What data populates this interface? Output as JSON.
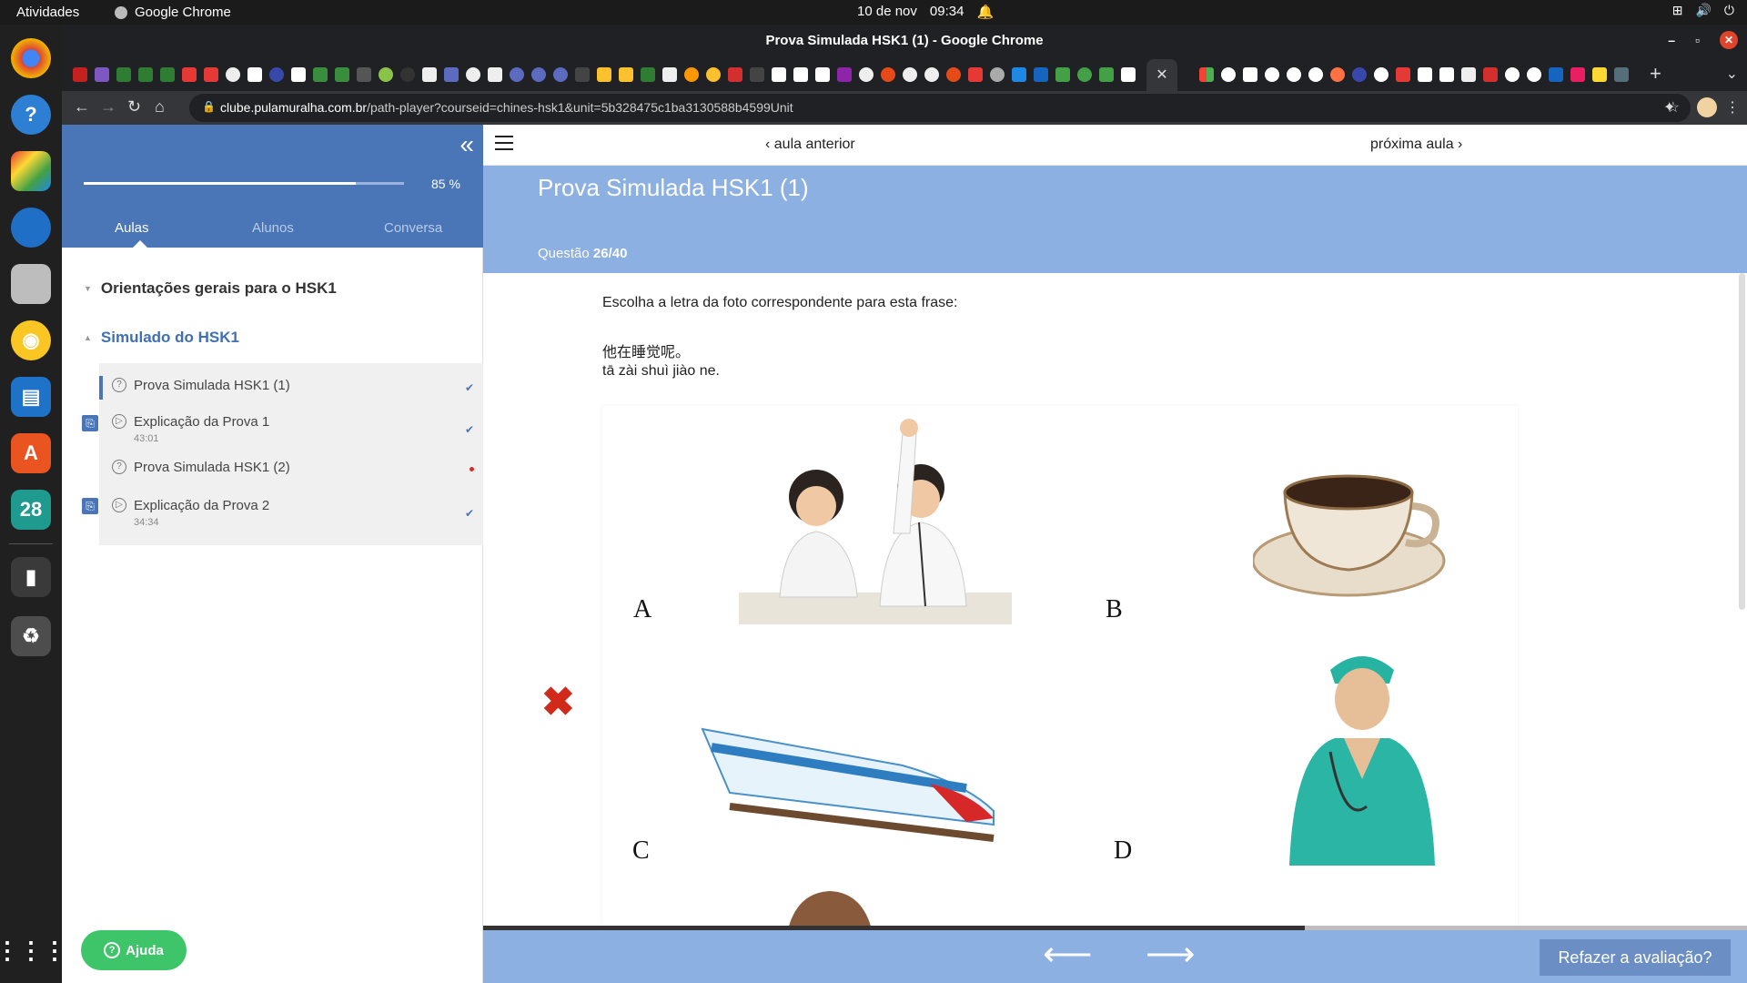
{
  "os": {
    "activities": "Atividades",
    "app_name": "Google Chrome",
    "date": "10 de nov",
    "time": "09:34"
  },
  "dock": {
    "calendar_day": "28"
  },
  "browser": {
    "window_title": "Prova Simulada HSK1 (1) - Google Chrome",
    "url_host": "clube.pulamuralha.com.br",
    "url_path": "/path-player?courseid=chines-hsk1&unit=5b328475c1ba3130588b4599Unit"
  },
  "sidebar": {
    "progress_percent": 85,
    "progress_label": "85 %",
    "tabs": [
      "Aulas",
      "Alunos",
      "Conversa"
    ],
    "sections": [
      {
        "title": "Orientações gerais para o HSK1"
      },
      {
        "title": "Simulado do HSK1"
      }
    ],
    "lessons": [
      {
        "name": "Prova Simulada HSK1 (1)",
        "duration": "",
        "status": "done"
      },
      {
        "name": "Explicação da Prova 1",
        "duration": "43:01",
        "status": "done"
      },
      {
        "name": "Prova Simulada HSK1 (2)",
        "duration": "",
        "status": "pending"
      },
      {
        "name": "Explicação da Prova 2",
        "duration": "34:34",
        "status": "done"
      }
    ],
    "help_label": "Ajuda"
  },
  "main": {
    "prev_label": "aula anterior",
    "next_label": "próxima aula",
    "title": "Prova Simulada HSK1 (1)",
    "question_label": "Questão",
    "question_number": "26/40",
    "instruction": "Escolha a letra da foto correspondente para esta frase:",
    "sentence_zh": "他在睡觉呢。",
    "sentence_pinyin": "tā zài shuì jiào ne.",
    "options": [
      "A",
      "B",
      "C",
      "D"
    ],
    "answer_status": "wrong",
    "redo_label": "Refazer a avaliação?",
    "bottom_progress_fraction": 0.65
  },
  "colors": {
    "sidebar_header": "#4a76b8",
    "question_header": "#8cb0e1",
    "help_button": "#3ec56a",
    "wrong_mark": "#d12a1a"
  }
}
